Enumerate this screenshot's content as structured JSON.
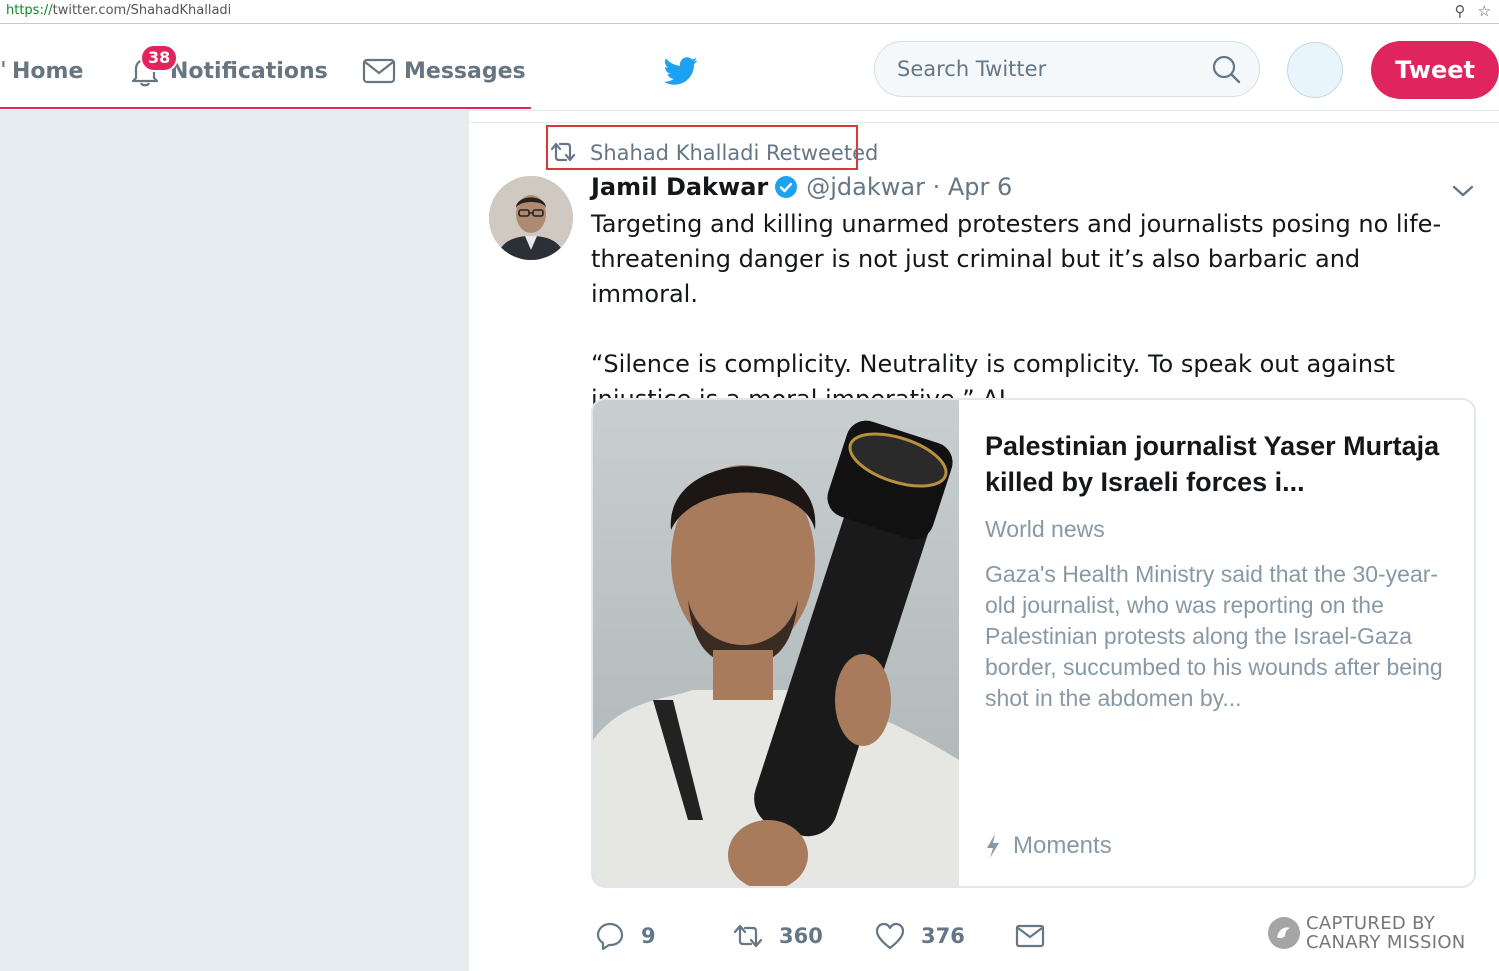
{
  "browser": {
    "url_scheme": "https://",
    "url_rest": "twitter.com/ShahadKhalladi"
  },
  "nav": {
    "home_label": "Home",
    "notifications_label": "Notifications",
    "notifications_count": "38",
    "messages_label": "Messages",
    "search_placeholder": "Search Twitter",
    "tweet_button_label": "Tweet"
  },
  "colors": {
    "accent": "#e0245e",
    "twitter_blue": "#1da1f2",
    "muted": "#657786",
    "highlight_box": "#d9363e"
  },
  "tweet": {
    "retweeted_by": "Shahad Khalladi Retweeted",
    "author_name": "Jamil Dakwar",
    "author_handle_date": "@jdakwar · Apr 6",
    "text": "Targeting and killing unarmed protesters and journalists posing no life-threatening danger is not just criminal but it’s also barbaric and immoral.\n\n“Silence is complicity. Neutrality is complicity. To speak out against injustice is a moral imperative.” AL",
    "card": {
      "title": "Palestinian journalist Yaser Murtaja killed by Israeli forces i...",
      "source": "World news",
      "description": "Gaza's Health Ministry said that the 30-year-old journalist, who was reporting on the Palestinian protests along the Israel-Gaza border, succumbed to his wounds after being shot in the abdomen by...",
      "footer": "Moments"
    },
    "reply_count": "9",
    "retweet_count": "360",
    "like_count": "376"
  },
  "watermark": {
    "line1": "CAPTURED BY",
    "line2": "CANARY MISSION"
  }
}
